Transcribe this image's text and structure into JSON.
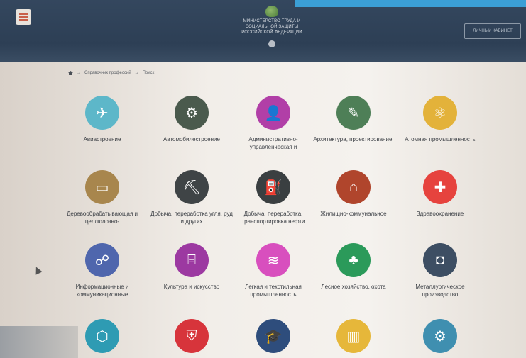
{
  "header": {
    "ministry_line1": "МИНИСТЕРСТВО ТРУДА И",
    "ministry_line2": "СОЦИАЛЬНОЙ ЗАЩИТЫ",
    "ministry_line3": "РОССИЙСКОЙ ФЕДЕРАЦИИ",
    "cabinet_button": "ЛИЧНЫЙ КАБИНЕТ"
  },
  "breadcrumb": {
    "item1": "Справочник профессий",
    "item2": "Поиск",
    "sep": "→"
  },
  "professions": [
    {
      "label": "Авиастроение",
      "color": "#5db7c9",
      "icon": "airplane-icon",
      "glyph": "✈"
    },
    {
      "label": "Автомобилестроение",
      "color": "#4a5a4d",
      "icon": "car-assembly-icon",
      "glyph": "⚙"
    },
    {
      "label": "Административно-управленческая и",
      "color": "#b13fa7",
      "icon": "manager-icon",
      "glyph": "👤"
    },
    {
      "label": "Архитектура, проектирование,",
      "color": "#4e7f57",
      "icon": "blueprint-icon",
      "glyph": "✎"
    },
    {
      "label": "Атомная промышленность",
      "color": "#e3b23a",
      "icon": "atom-icon",
      "glyph": "⚛"
    },
    {
      "label": "Деревообрабатывающая и целлюлозно-",
      "color": "#a8864d",
      "icon": "sawmill-icon",
      "glyph": "▭"
    },
    {
      "label": "Добыча, переработка угля, руд и других",
      "color": "#3f4446",
      "icon": "excavator-icon",
      "glyph": "⛏"
    },
    {
      "label": "Добыча, переработка, транспортировка нефти",
      "color": "#3a3f41",
      "icon": "oil-pump-icon",
      "glyph": "⛽"
    },
    {
      "label": "Жилищно-коммунальное",
      "color": "#b0452c",
      "icon": "house-icon",
      "glyph": "⌂"
    },
    {
      "label": "Здравоохранение",
      "color": "#e6433e",
      "icon": "medical-kit-icon",
      "glyph": "✚"
    },
    {
      "label": "Информационные и коммуникационные",
      "color": "#4f66ad",
      "icon": "users-network-icon",
      "glyph": "☍"
    },
    {
      "label": "Культура и искусство",
      "color": "#9c39a1",
      "icon": "museum-icon",
      "glyph": "⌸"
    },
    {
      "label": "Легкая и текстильная промышленность",
      "color": "#d84fbe",
      "icon": "fabric-roll-icon",
      "glyph": "≋"
    },
    {
      "label": "Лесное хозяйство, охота",
      "color": "#2b9a5a",
      "icon": "forest-icon",
      "glyph": "♣"
    },
    {
      "label": "Металлургическое производство",
      "color": "#3d4e63",
      "icon": "welding-mask-icon",
      "glyph": "◘"
    },
    {
      "label": "",
      "color": "#2e9bb3",
      "icon": "molecule-icon",
      "glyph": "⬡"
    },
    {
      "label": "",
      "color": "#d7343b",
      "icon": "shield-icon",
      "glyph": "⛨"
    },
    {
      "label": "",
      "color": "#2e4d7c",
      "icon": "graduation-cap-icon",
      "glyph": "🎓"
    },
    {
      "label": "",
      "color": "#e6b73a",
      "icon": "buildings-icon",
      "glyph": "▥"
    },
    {
      "label": "",
      "color": "#3f8fb0",
      "icon": "gear-icon",
      "glyph": "⚙"
    }
  ]
}
